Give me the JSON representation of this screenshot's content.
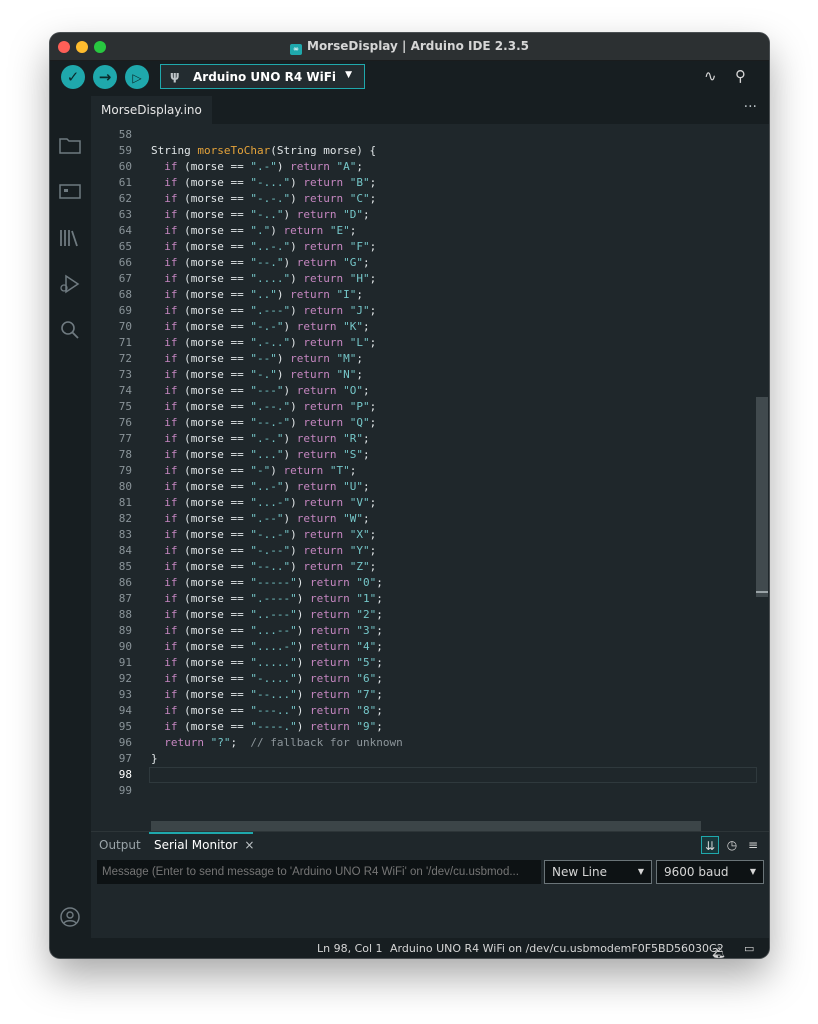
{
  "window": {
    "title": "MorseDisplay | Arduino IDE 2.3.5"
  },
  "toolbar": {
    "verify_icon": "check-icon",
    "upload_icon": "arrow-right-icon",
    "debug_icon": "debug-play-icon",
    "board": "Arduino UNO R4 WiFi",
    "plotter_icon": "pulse-icon",
    "serial_icon": "magnifier-icon"
  },
  "sidebar": {
    "items": [
      "folder-icon",
      "board-icon",
      "library-icon",
      "debug-icon",
      "search-icon"
    ],
    "account_icon": "account-icon"
  },
  "tabs": {
    "active": "MorseDisplay.ino",
    "more": "···"
  },
  "editor": {
    "lines": [
      {
        "n": "58",
        "code": ""
      },
      {
        "n": "59",
        "code": "String morseToChar(String morse) {"
      },
      {
        "n": "60",
        "code": "  if (morse == \".-\") return \"A\";"
      },
      {
        "n": "61",
        "code": "  if (morse == \"-...\") return \"B\";"
      },
      {
        "n": "62",
        "code": "  if (morse == \"-.-.\") return \"C\";"
      },
      {
        "n": "63",
        "code": "  if (morse == \"-..\") return \"D\";"
      },
      {
        "n": "64",
        "code": "  if (morse == \".\") return \"E\";"
      },
      {
        "n": "65",
        "code": "  if (morse == \"..-.\") return \"F\";"
      },
      {
        "n": "66",
        "code": "  if (morse == \"--.\") return \"G\";"
      },
      {
        "n": "67",
        "code": "  if (morse == \"....\") return \"H\";"
      },
      {
        "n": "68",
        "code": "  if (morse == \"..\") return \"I\";"
      },
      {
        "n": "69",
        "code": "  if (morse == \".---\") return \"J\";"
      },
      {
        "n": "70",
        "code": "  if (morse == \"-.-\") return \"K\";"
      },
      {
        "n": "71",
        "code": "  if (morse == \".-..\") return \"L\";"
      },
      {
        "n": "72",
        "code": "  if (morse == \"--\") return \"M\";"
      },
      {
        "n": "73",
        "code": "  if (morse == \"-.\") return \"N\";"
      },
      {
        "n": "74",
        "code": "  if (morse == \"---\") return \"O\";"
      },
      {
        "n": "75",
        "code": "  if (morse == \".--.\") return \"P\";"
      },
      {
        "n": "76",
        "code": "  if (morse == \"--.-\") return \"Q\";"
      },
      {
        "n": "77",
        "code": "  if (morse == \".-.\") return \"R\";"
      },
      {
        "n": "78",
        "code": "  if (morse == \"...\") return \"S\";"
      },
      {
        "n": "79",
        "code": "  if (morse == \"-\") return \"T\";"
      },
      {
        "n": "80",
        "code": "  if (morse == \"..-\") return \"U\";"
      },
      {
        "n": "81",
        "code": "  if (morse == \"...-\") return \"V\";"
      },
      {
        "n": "82",
        "code": "  if (morse == \".--\") return \"W\";"
      },
      {
        "n": "83",
        "code": "  if (morse == \"-..-\") return \"X\";"
      },
      {
        "n": "84",
        "code": "  if (morse == \"-.--\") return \"Y\";"
      },
      {
        "n": "85",
        "code": "  if (morse == \"--..\") return \"Z\";"
      },
      {
        "n": "86",
        "code": "  if (morse == \"-----\") return \"0\";"
      },
      {
        "n": "87",
        "code": "  if (morse == \".----\") return \"1\";"
      },
      {
        "n": "88",
        "code": "  if (morse == \"..---\") return \"2\";"
      },
      {
        "n": "89",
        "code": "  if (morse == \"...--\") return \"3\";"
      },
      {
        "n": "90",
        "code": "  if (morse == \"....-\") return \"4\";"
      },
      {
        "n": "91",
        "code": "  if (morse == \".....\") return \"5\";"
      },
      {
        "n": "92",
        "code": "  if (morse == \"-....\") return \"6\";"
      },
      {
        "n": "93",
        "code": "  if (morse == \"--...\") return \"7\";"
      },
      {
        "n": "94",
        "code": "  if (morse == \"---..\") return \"8\";"
      },
      {
        "n": "95",
        "code": "  if (morse == \"----.\") return \"9\";"
      },
      {
        "n": "96",
        "code": "  return \"?\";  // fallback for unknown"
      },
      {
        "n": "97",
        "code": "}"
      },
      {
        "n": "98",
        "code": ""
      },
      {
        "n": "99",
        "code": ""
      }
    ],
    "current_line": "98"
  },
  "panel": {
    "tabs": [
      "Output",
      "Serial Monitor"
    ],
    "active_tab": "Serial Monitor",
    "close": "×",
    "icons": [
      "autoscroll-icon",
      "clock-icon",
      "clear-icon"
    ],
    "message_placeholder": "Message (Enter to send message to 'Arduino UNO R4 WiFi' on '/dev/cu.usbmod...",
    "line_ending": "New Line",
    "baud": "9600 baud"
  },
  "status": {
    "position": "Ln 98, Col 1",
    "board_port": "Arduino UNO R4 WiFi on /dev/cu.usbmodemF0F5BD56030C2",
    "notifications": "2"
  }
}
